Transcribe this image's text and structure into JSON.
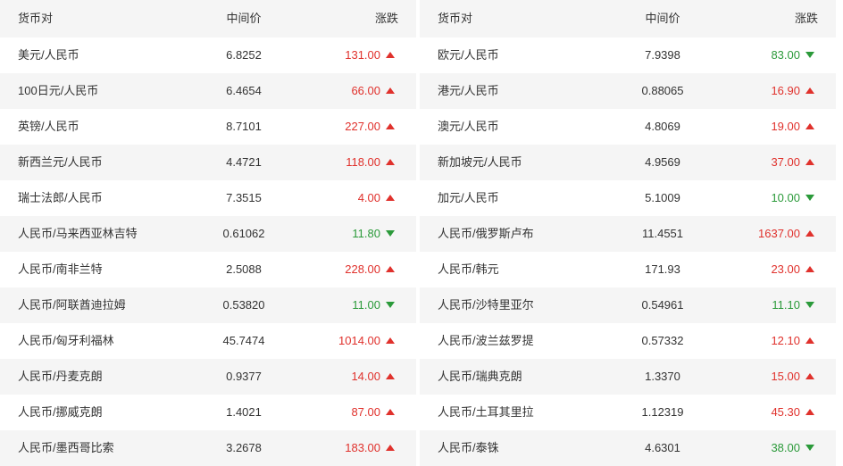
{
  "headers": {
    "pair": "货币对",
    "mid": "中间价",
    "change": "涨跌"
  },
  "colors": {
    "up": "#e0312c",
    "down": "#2b9a3a",
    "stripe": "#f5f5f5"
  },
  "left_rows": [
    {
      "pair": "美元/人民币",
      "mid": "6.8252",
      "change": "131.00",
      "dir": "up"
    },
    {
      "pair": "100日元/人民币",
      "mid": "6.4654",
      "change": "66.00",
      "dir": "up"
    },
    {
      "pair": "英镑/人民币",
      "mid": "8.7101",
      "change": "227.00",
      "dir": "up"
    },
    {
      "pair": "新西兰元/人民币",
      "mid": "4.4721",
      "change": "118.00",
      "dir": "up"
    },
    {
      "pair": "瑞士法郎/人民币",
      "mid": "7.3515",
      "change": "4.00",
      "dir": "up"
    },
    {
      "pair": "人民币/马来西亚林吉特",
      "mid": "0.61062",
      "change": "11.80",
      "dir": "down"
    },
    {
      "pair": "人民币/南非兰特",
      "mid": "2.5088",
      "change": "228.00",
      "dir": "up"
    },
    {
      "pair": "人民币/阿联酋迪拉姆",
      "mid": "0.53820",
      "change": "11.00",
      "dir": "down"
    },
    {
      "pair": "人民币/匈牙利福林",
      "mid": "45.7474",
      "change": "1014.00",
      "dir": "up"
    },
    {
      "pair": "人民币/丹麦克朗",
      "mid": "0.9377",
      "change": "14.00",
      "dir": "up"
    },
    {
      "pair": "人民币/挪威克朗",
      "mid": "1.4021",
      "change": "87.00",
      "dir": "up"
    },
    {
      "pair": "人民币/墨西哥比索",
      "mid": "3.2678",
      "change": "183.00",
      "dir": "up"
    }
  ],
  "right_rows": [
    {
      "pair": "欧元/人民币",
      "mid": "7.9398",
      "change": "83.00",
      "dir": "down"
    },
    {
      "pair": "港元/人民币",
      "mid": "0.88065",
      "change": "16.90",
      "dir": "up"
    },
    {
      "pair": "澳元/人民币",
      "mid": "4.8069",
      "change": "19.00",
      "dir": "up"
    },
    {
      "pair": "新加坡元/人民币",
      "mid": "4.9569",
      "change": "37.00",
      "dir": "up"
    },
    {
      "pair": "加元/人民币",
      "mid": "5.1009",
      "change": "10.00",
      "dir": "down"
    },
    {
      "pair": "人民币/俄罗斯卢布",
      "mid": "11.4551",
      "change": "1637.00",
      "dir": "up"
    },
    {
      "pair": "人民币/韩元",
      "mid": "171.93",
      "change": "23.00",
      "dir": "up"
    },
    {
      "pair": "人民币/沙特里亚尔",
      "mid": "0.54961",
      "change": "11.10",
      "dir": "down"
    },
    {
      "pair": "人民币/波兰兹罗提",
      "mid": "0.57332",
      "change": "12.10",
      "dir": "up"
    },
    {
      "pair": "人民币/瑞典克朗",
      "mid": "1.3370",
      "change": "15.00",
      "dir": "up"
    },
    {
      "pair": "人民币/土耳其里拉",
      "mid": "1.12319",
      "change": "45.30",
      "dir": "up"
    },
    {
      "pair": "人民币/泰铢",
      "mid": "4.6301",
      "change": "38.00",
      "dir": "down"
    }
  ]
}
